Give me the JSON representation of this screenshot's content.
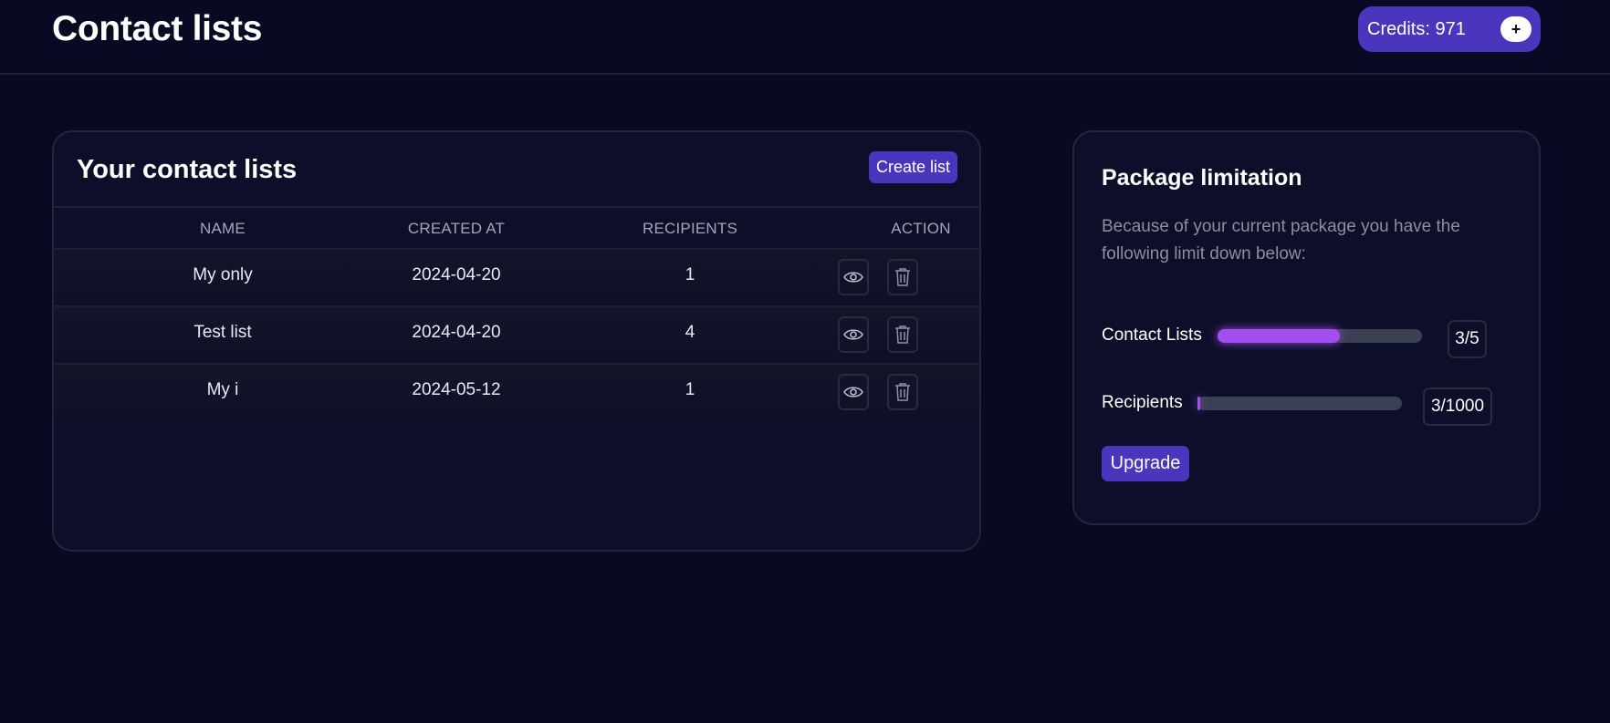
{
  "header": {
    "title": "Contact lists",
    "credits_label": "Credits: 971",
    "credits_add_label": "+"
  },
  "lists": {
    "title": "Your contact lists",
    "create_label": "Create list",
    "columns": [
      "NAME",
      "CREATED AT",
      "RECIPIENTS",
      "ACTION"
    ],
    "rows": [
      {
        "name": "My only",
        "created_at": "2024-04-20",
        "recipients": "1"
      },
      {
        "name": "Test list",
        "created_at": "2024-04-20",
        "recipients": "4"
      },
      {
        "name": "My i",
        "created_at": "2024-05-12",
        "recipients": "1"
      }
    ],
    "row_actions": [
      "eye-icon",
      "trash-icon"
    ]
  },
  "package": {
    "title": "Package limitation",
    "description": "Because of your current package you have the following limit down below:",
    "limits": [
      {
        "label": "Contact Lists",
        "value": "3/5",
        "used": 3,
        "max": 5
      },
      {
        "label": "Recipients",
        "value": "3/1000",
        "used": 3,
        "max": 1000
      }
    ],
    "upgrade_label": "Upgrade"
  },
  "colors": {
    "background": "#070a22",
    "card": "#0d0f2a",
    "accent": "#4a35bd",
    "progress_fill": "#a44ef0",
    "progress_track": "#3a4152"
  }
}
